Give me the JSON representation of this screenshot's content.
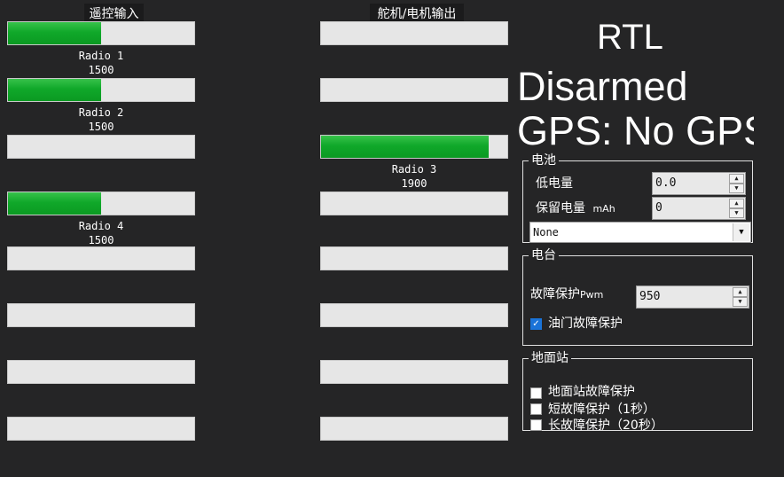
{
  "rc_input": {
    "title": "遥控输入",
    "bars": [
      {
        "level": 0.5,
        "label": "Radio 1",
        "value": "1500"
      },
      {
        "level": 0.5,
        "label": "Radio 2",
        "value": "1500"
      },
      {
        "level": 0,
        "label": "",
        "value": ""
      },
      {
        "level": 0.5,
        "label": "Radio 4",
        "value": "1500"
      },
      {
        "level": 0,
        "label": "",
        "value": ""
      },
      {
        "level": 0,
        "label": "",
        "value": ""
      },
      {
        "level": 0,
        "label": "",
        "value": ""
      },
      {
        "level": 0,
        "label": "",
        "value": ""
      }
    ]
  },
  "servo_output": {
    "title": "舵机/电机输出",
    "bars": [
      {
        "level": 0,
        "label": "",
        "value": ""
      },
      {
        "level": 0,
        "label": "",
        "value": ""
      },
      {
        "level": 0.9,
        "label": "Radio 3",
        "value": "1900"
      },
      {
        "level": 0,
        "label": "",
        "value": ""
      },
      {
        "level": 0,
        "label": "",
        "value": ""
      },
      {
        "level": 0,
        "label": "",
        "value": ""
      },
      {
        "level": 0,
        "label": "",
        "value": ""
      },
      {
        "level": 0,
        "label": "",
        "value": ""
      }
    ]
  },
  "status": {
    "mode": "RTL",
    "armed": "Disarmed",
    "gps": "GPS: No GPS"
  },
  "battery": {
    "title": "电池",
    "low_label": "低电量",
    "low_value": "0.0",
    "reserve_label": "保留电量",
    "reserve_unit": "mAh",
    "reserve_value": "0",
    "action": "None"
  },
  "radio": {
    "title": "电台",
    "failsafe_label": "故障保护",
    "failsafe_unit": "Pwm",
    "failsafe_value": "950",
    "throttle_failsafe_label": "油门故障保护",
    "throttle_failsafe_checked": true
  },
  "gcs": {
    "title": "地面站",
    "gcs_failsafe_label": "地面站故障保护",
    "short_failsafe_label": "短故障保护（1秒）",
    "long_failsafe_label": "长故障保护（20秒）"
  },
  "colors": {
    "bar_fill": "#10a82a",
    "bar_bg": "#e6e6e6",
    "background": "#252526",
    "checkbox_checked": "#1a73d8"
  }
}
